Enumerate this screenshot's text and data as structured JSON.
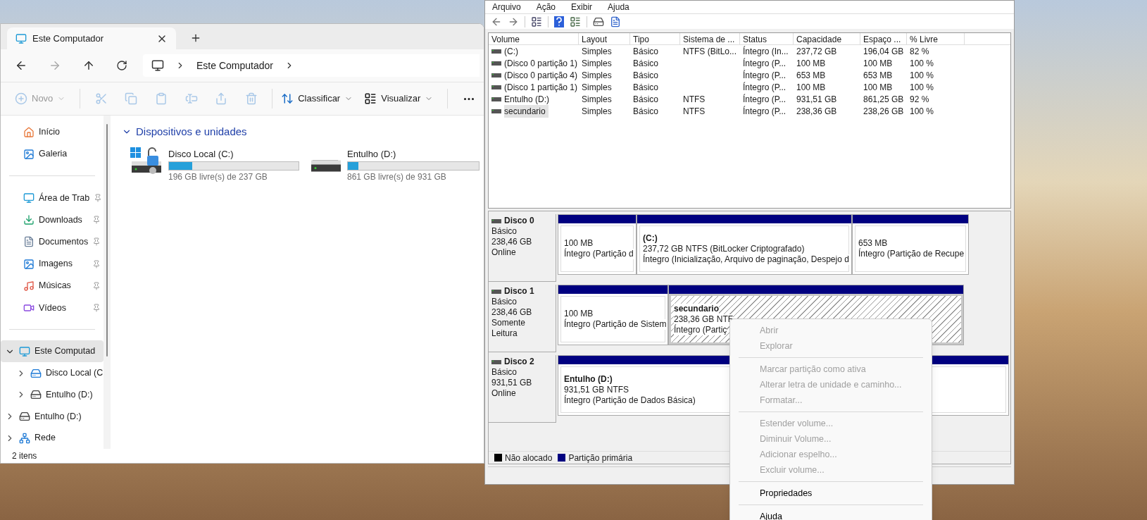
{
  "explorer": {
    "tab": {
      "title": "Este Computador",
      "selected": true
    },
    "address": {
      "crumbs": [
        "Este Computador"
      ]
    },
    "toolbar": [
      {
        "kind": "new",
        "label": "Novo",
        "disabled": true
      },
      {
        "kind": "cut",
        "disabled": true
      },
      {
        "kind": "copy",
        "disabled": true
      },
      {
        "kind": "paste",
        "disabled": true
      },
      {
        "kind": "rename",
        "disabled": true
      },
      {
        "kind": "share",
        "disabled": true
      },
      {
        "kind": "delete",
        "disabled": true
      },
      {
        "kind": "sort",
        "label": "Classificar",
        "disabled": false
      },
      {
        "kind": "view",
        "label": "Visualizar",
        "disabled": false
      },
      {
        "kind": "more",
        "disabled": false
      }
    ],
    "sidebar": {
      "groups": [
        [
          {
            "label": "Início",
            "pinned": false
          },
          {
            "label": "Galeria",
            "pinned": false
          }
        ],
        [
          {
            "label": "Área de Trab",
            "pinned": true
          },
          {
            "label": "Downloads",
            "pinned": true
          },
          {
            "label": "Documentos",
            "pinned": true
          },
          {
            "label": "Imagens",
            "pinned": true
          },
          {
            "label": "Músicas",
            "pinned": true
          },
          {
            "label": "Vídeos",
            "pinned": true
          }
        ]
      ],
      "tree": [
        {
          "kind": "computer",
          "label": "Este Computad",
          "expanded": true,
          "selected": true,
          "children": [
            {
              "kind": "system-drive",
              "label": "Disco Local (C",
              "expanded": false,
              "selected": false
            },
            {
              "kind": "drive",
              "label": "Entulho (D:)",
              "expanded": false,
              "selected": false
            }
          ]
        },
        {
          "kind": "drive",
          "label": "Entulho (D:)",
          "expanded": false,
          "selected": false
        },
        {
          "kind": "network",
          "label": "Rede",
          "expanded": false,
          "selected": false
        }
      ]
    },
    "section": {
      "title": "Dispositivos e unidades",
      "expanded": true
    },
    "drives": [
      {
        "kind": "system",
        "name": "Disco Local (C:)",
        "level": 0.18,
        "detail": "196 GB livre(s) de 237 GB"
      },
      {
        "kind": "plain",
        "name": "Entulho (D:)",
        "level": 0.08,
        "detail": "861 GB livre(s) de 931 GB"
      }
    ],
    "status_bar": "2 itens"
  },
  "disk_management": {
    "menu": [
      "Arquivo",
      "Ação",
      "Exibir",
      "Ajuda"
    ],
    "table": {
      "columns": [
        "Volume",
        "Layout",
        "Tipo",
        "Sistema de ...",
        "Status",
        "Capacidade",
        "Espaço ...",
        "% Livre"
      ],
      "rows": [
        {
          "cells": [
            " (C:)",
            "Simples",
            "Básico",
            "NTFS (BitLo...",
            "Íntegro (In...",
            "237,72 GB",
            "196,04 GB",
            "82 %"
          ],
          "selected": false
        },
        {
          "cells": [
            "(Disco 0 partição 1)",
            "Simples",
            "Básico",
            "",
            "Íntegro (P...",
            "100 MB",
            "100 MB",
            "100 %"
          ],
          "selected": false
        },
        {
          "cells": [
            "(Disco 0 partição 4)",
            "Simples",
            "Básico",
            "",
            "Íntegro (P...",
            "653 MB",
            "653 MB",
            "100 %"
          ],
          "selected": false
        },
        {
          "cells": [
            "(Disco 1 partição 1)",
            "Simples",
            "Básico",
            "",
            "Íntegro (P...",
            "100 MB",
            "100 MB",
            "100 %"
          ],
          "selected": false
        },
        {
          "cells": [
            "Entulho (D:)",
            "Simples",
            "Básico",
            "NTFS",
            "Íntegro (P...",
            "931,51 GB",
            "861,25 GB",
            "92 %"
          ],
          "selected": false
        },
        {
          "cells": [
            "secundario",
            "Simples",
            "Básico",
            "NTFS",
            "Íntegro (P...",
            "238,36 GB",
            "238,26 GB",
            "100 %"
          ],
          "selected": true
        }
      ]
    },
    "disks": [
      {
        "name": "Disco 0",
        "type": "Básico",
        "size": "238,46 GB",
        "status": "Online",
        "partitions": [
          {
            "lines": [
              "100 MB",
              "Íntegro (Partição d"
            ],
            "selected": false
          },
          {
            "title": "(C:)",
            "lines": [
              "237,72 GB NTFS (BitLocker Criptografado)",
              "Íntegro (Inicialização, Arquivo de paginação, Despejo d"
            ],
            "selected": false
          },
          {
            "lines": [
              "653 MB",
              "Íntegro (Partição de Recupe"
            ],
            "selected": false
          }
        ]
      },
      {
        "name": "Disco 1",
        "type": "Básico",
        "size": "238,46 GB",
        "status": "Somente Leitura",
        "partitions": [
          {
            "lines": [
              "100 MB",
              "Íntegro (Partição de Sistem"
            ],
            "selected": false
          },
          {
            "title": "secundario",
            "lines": [
              "238,36 GB NTF",
              "Íntegro (Partiç"
            ],
            "selected": true
          }
        ]
      },
      {
        "name": "Disco 2",
        "type": "Básico",
        "size": "931,51 GB",
        "status": "Online",
        "partitions": [
          {
            "title": "Entulho  (D:)",
            "lines": [
              "931,51 GB NTFS",
              "Íntegro (Partição de Dados Básica)"
            ],
            "selected": false
          }
        ]
      }
    ],
    "legend": [
      {
        "label": "Não alocado",
        "color": "#000000"
      },
      {
        "label": "Partição primária",
        "color": "#000080"
      }
    ]
  },
  "context_menu": [
    [
      {
        "label": "Abrir",
        "disabled": true
      },
      {
        "label": "Explorar",
        "disabled": true
      }
    ],
    [
      {
        "label": "Marcar partição como ativa",
        "disabled": true
      },
      {
        "label": "Alterar letra de unidade e caminho...",
        "disabled": true
      },
      {
        "label": "Formatar...",
        "disabled": true
      }
    ],
    [
      {
        "label": "Estender volume...",
        "disabled": true
      },
      {
        "label": "Diminuir Volume...",
        "disabled": true
      },
      {
        "label": "Adicionar espelho...",
        "disabled": true
      },
      {
        "label": "Excluir volume...",
        "disabled": true
      }
    ],
    [
      {
        "label": "Propriedades",
        "disabled": false
      }
    ],
    [
      {
        "label": "Ajuda",
        "disabled": false
      }
    ]
  ]
}
